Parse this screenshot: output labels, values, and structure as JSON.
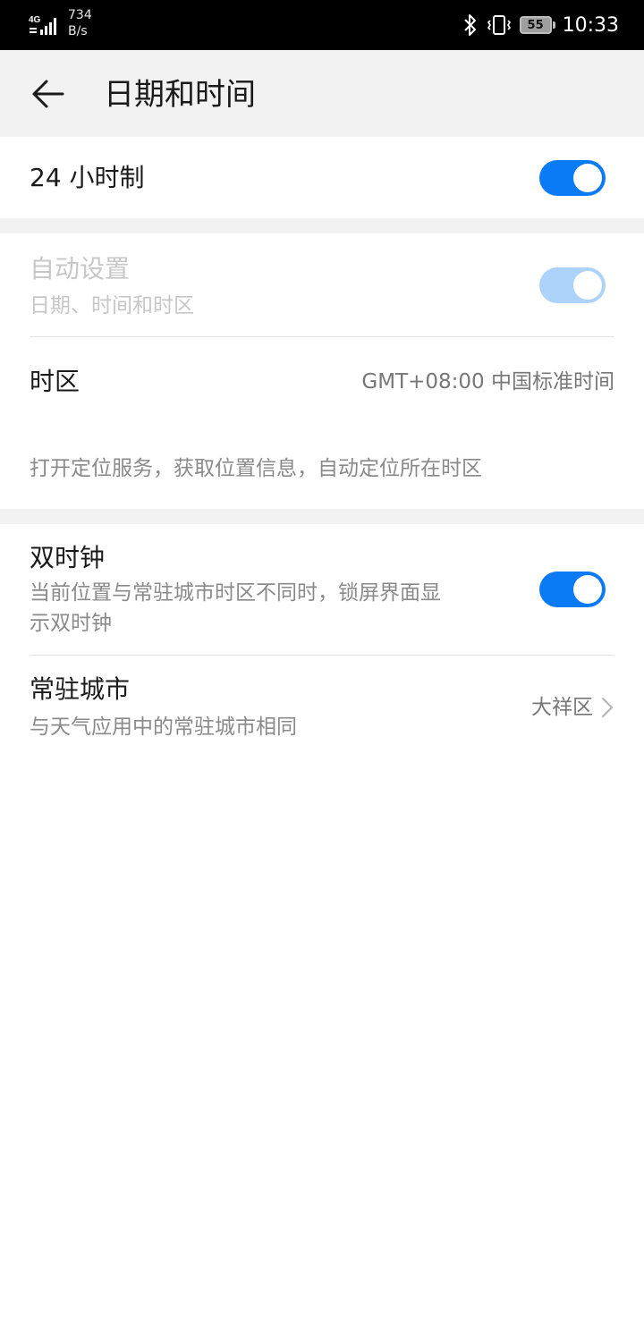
{
  "status_bar": {
    "network_type": "4G",
    "speed_value": "734",
    "speed_unit": "B/s",
    "battery": "55",
    "time": "10:33",
    "icons": [
      "signal-icon",
      "bluetooth-icon",
      "vibrate-icon",
      "battery-icon"
    ]
  },
  "header": {
    "title": "日期和时间",
    "back_icon": "back-arrow-icon"
  },
  "settings": {
    "hour24": {
      "label": "24 小时制",
      "enabled": true
    },
    "auto_set": {
      "label": "自动设置",
      "sublabel": "日期、时间和时区",
      "enabled": true,
      "disabled_state": true
    },
    "timezone": {
      "label": "时区",
      "value": "GMT+08:00 中国标准时间",
      "hint": "打开定位服务，获取位置信息，自动定位所在时区"
    },
    "dual_clock": {
      "label": "双时钟",
      "sublabel_line1": "当前位置与常驻城市时区不同时，锁屏界面显",
      "sublabel_line2": "示双时钟",
      "enabled": true
    },
    "home_city": {
      "label": "常驻城市",
      "sublabel": "与天气应用中的常驻城市相同",
      "value": "大祥区"
    }
  },
  "colors": {
    "accent": "#0a7bf5",
    "accent_disabled": "#aed3fb",
    "background_gray": "#f2f2f2"
  }
}
